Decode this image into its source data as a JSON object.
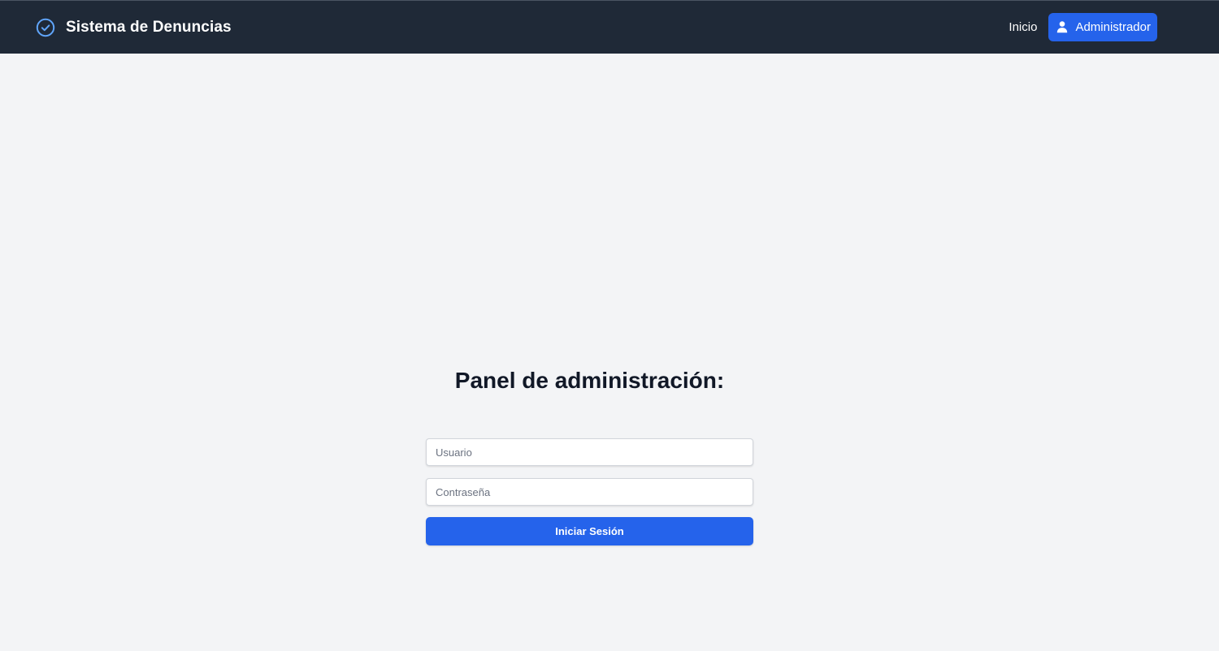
{
  "header": {
    "brand_icon": "check-circle-icon",
    "brand_title": "Sistema de Denuncias",
    "nav": {
      "home_label": "Inicio",
      "admin_label": "Administrador",
      "admin_icon": "user-icon"
    }
  },
  "main": {
    "title": "Panel de administración:",
    "form": {
      "username_placeholder": "Usuario",
      "username_value": "",
      "password_placeholder": "Contraseña",
      "password_value": "",
      "submit_label": "Iniciar Sesión"
    }
  },
  "colors": {
    "navbar_bg": "#1f2937",
    "accent": "#2563eb",
    "page_bg": "#f3f4f6",
    "brand_icon": "#60a5fa"
  }
}
